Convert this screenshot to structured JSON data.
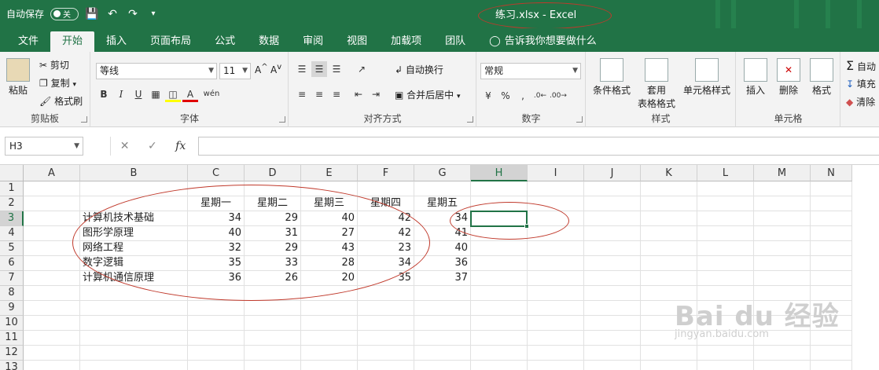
{
  "quick_access": {
    "autosave_label": "自动保存",
    "autosave_state": "关",
    "save_icon": "save-icon",
    "undo_icon": "undo-icon",
    "redo_icon": "redo-icon",
    "customize_icon": "customize-icon"
  },
  "window_title": "练习.xlsx  -  Excel",
  "accent_color": "#217346",
  "annotation_color": "#c0392b",
  "ribbon_tabs": [
    {
      "label": "文件"
    },
    {
      "label": "开始",
      "active": true
    },
    {
      "label": "插入"
    },
    {
      "label": "页面布局"
    },
    {
      "label": "公式"
    },
    {
      "label": "数据"
    },
    {
      "label": "审阅"
    },
    {
      "label": "视图"
    },
    {
      "label": "加载项"
    },
    {
      "label": "团队"
    }
  ],
  "tell_me": "告诉我你想要做什么",
  "ribbon": {
    "clipboard": {
      "label": "剪贴板",
      "paste": "粘贴",
      "cut": "剪切",
      "copy": "复制",
      "format_painter": "格式刷"
    },
    "font": {
      "label": "字体",
      "font_name": "等线",
      "font_size": "11",
      "bold": "B",
      "italic": "I",
      "underline": "U",
      "phonetic": "wén"
    },
    "alignment": {
      "label": "对齐方式",
      "wrap": "自动换行",
      "merge": "合并后居中"
    },
    "number": {
      "label": "数字",
      "format": "常规",
      "percent": "%"
    },
    "styles": {
      "label": "样式",
      "conditional": "条件格式",
      "table": "套用",
      "table2": "表格格式",
      "cell_styles": "单元格样式"
    },
    "cells": {
      "label": "单元格",
      "insert": "插入",
      "delete": "删除",
      "format": "格式"
    },
    "editing": {
      "autosum": "自动",
      "fill": "填充",
      "clear": "清除"
    }
  },
  "formula_bar": {
    "name_box": "H3",
    "fx": "fx",
    "value": ""
  },
  "columns": [
    "A",
    "B",
    "C",
    "D",
    "E",
    "F",
    "G",
    "H",
    "I",
    "J",
    "K",
    "L",
    "M",
    "N"
  ],
  "rows": [
    "1",
    "2",
    "3",
    "4",
    "5",
    "6",
    "7",
    "8",
    "9",
    "10",
    "11",
    "12",
    "13"
  ],
  "selected_cell": "H3",
  "sheet": {
    "headers": [
      "星期一",
      "星期二",
      "星期三",
      "星期四",
      "星期五"
    ],
    "data_rows": [
      {
        "name": "计算机技术基础",
        "values": [
          34,
          29,
          40,
          42,
          34
        ]
      },
      {
        "name": "图形学原理",
        "values": [
          40,
          31,
          27,
          42,
          41
        ]
      },
      {
        "name": "网络工程",
        "values": [
          32,
          29,
          43,
          23,
          40
        ]
      },
      {
        "name": "数字逻辑",
        "values": [
          35,
          33,
          28,
          34,
          36
        ]
      },
      {
        "name": "计算机通信原理",
        "values": [
          36,
          26,
          20,
          35,
          37
        ]
      }
    ]
  },
  "watermark": {
    "main": "Bai du 经验",
    "sub": "jingyan.baidu.com"
  }
}
